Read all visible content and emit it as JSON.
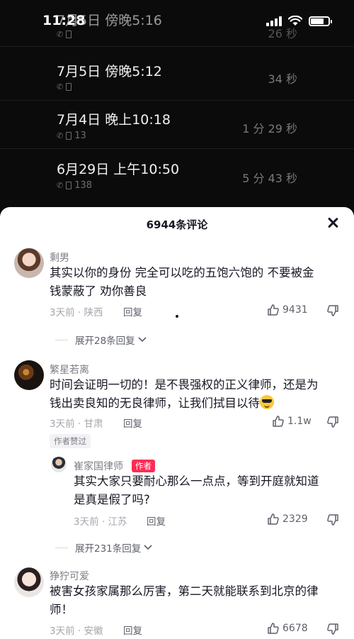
{
  "status_bar": {
    "time": "11:28"
  },
  "call_log": [
    {
      "date": "7月5日 傍晚5:16",
      "number": "",
      "duration": "26 秒"
    },
    {
      "date": "7月5日 傍晚5:12",
      "number": "",
      "duration": "34 秒"
    },
    {
      "date": "7月4日 晚上10:18",
      "number": "13",
      "duration": "1 分 29 秒"
    },
    {
      "date": "6月29日 上午10:50",
      "number": "138",
      "duration": "5 分 43 秒"
    }
  ],
  "comments_panel": {
    "title": "6944条评论",
    "close_icon": "close-icon"
  },
  "comments": [
    {
      "user": "剩男",
      "text_line1": "其实以你的身份 完全可以吃的五饱六饱的 不要被金",
      "text_line2": "钱蒙蔽了 劝你善良",
      "time_location": "3天前 · 陕西",
      "reply_label": "回复",
      "likes": "9431",
      "expand_label": "展开28条回复"
    },
    {
      "user": "繁星若离",
      "text_line1": "时间会证明一切的！是不畏强权的正义律师，还是为",
      "text_line2": "钱出卖良知的无良律师，让我们拭目以待",
      "time_location": "3天前 · 甘肃",
      "reply_label": "回复",
      "likes": "1.1w",
      "author_liked": "作者赞过",
      "reply": {
        "user": "崔家国律师",
        "author_badge": "作者",
        "text_line1": "其实大家只要耐心那么一点点，等到开庭就知道",
        "text_line2": "是真是假了吗?",
        "time_location": "3天前 · 江苏",
        "reply_label": "回复",
        "likes": "2329"
      },
      "expand_label": "展开231条回复"
    },
    {
      "user": "狰狞可爱",
      "text_line1": "被害女孩家属那么厉害，第二天就能联系到北京的律",
      "text_line2": "师！",
      "time_location": "3天前 · 安徽",
      "reply_label": "回复",
      "likes": "6678"
    }
  ]
}
